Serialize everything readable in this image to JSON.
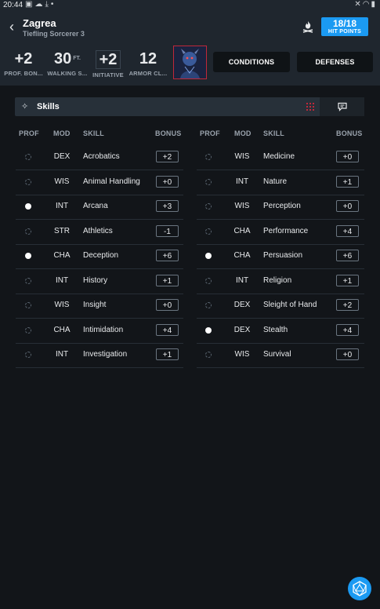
{
  "status_bar": {
    "time": "20:44",
    "left_icons": [
      "image-icon",
      "cloud-icon",
      "download-icon",
      "dot-icon"
    ],
    "right_icons": [
      "mute-icon",
      "wifi-icon",
      "battery-icon"
    ]
  },
  "header": {
    "name": "Zagrea",
    "subtitle": "Tiefling Sorcerer 3",
    "hit_points": {
      "value": "18/18",
      "label": "HIT POINTS"
    },
    "stats": {
      "proficiency": {
        "value": "+2",
        "label": "PROF. BON..."
      },
      "walking": {
        "value": "30",
        "unit": "FT.",
        "label": "WALKING S..."
      },
      "initiative": {
        "value": "+2",
        "label": "INITIATIVE"
      },
      "armor": {
        "value": "12",
        "label": "ARMOR CL..."
      }
    },
    "buttons": {
      "conditions": "CONDITIONS",
      "defenses": "DEFENSES"
    }
  },
  "skills_panel": {
    "title": "Skills",
    "columns": {
      "prof": "PROF",
      "mod": "MOD",
      "skill": "SKILL",
      "bonus": "BONUS"
    }
  },
  "skills_left": [
    {
      "prof": false,
      "mod": "DEX",
      "skill": "Acrobatics",
      "bonus": "+2"
    },
    {
      "prof": false,
      "mod": "WIS",
      "skill": "Animal Handling",
      "bonus": "+0"
    },
    {
      "prof": true,
      "mod": "INT",
      "skill": "Arcana",
      "bonus": "+3"
    },
    {
      "prof": false,
      "mod": "STR",
      "skill": "Athletics",
      "bonus": "-1"
    },
    {
      "prof": true,
      "mod": "CHA",
      "skill": "Deception",
      "bonus": "+6"
    },
    {
      "prof": false,
      "mod": "INT",
      "skill": "History",
      "bonus": "+1"
    },
    {
      "prof": false,
      "mod": "WIS",
      "skill": "Insight",
      "bonus": "+0"
    },
    {
      "prof": false,
      "mod": "CHA",
      "skill": "Intimidation",
      "bonus": "+4"
    },
    {
      "prof": false,
      "mod": "INT",
      "skill": "Investigation",
      "bonus": "+1"
    }
  ],
  "skills_right": [
    {
      "prof": false,
      "mod": "WIS",
      "skill": "Medicine",
      "bonus": "+0"
    },
    {
      "prof": false,
      "mod": "INT",
      "skill": "Nature",
      "bonus": "+1"
    },
    {
      "prof": false,
      "mod": "WIS",
      "skill": "Perception",
      "bonus": "+0"
    },
    {
      "prof": false,
      "mod": "CHA",
      "skill": "Performance",
      "bonus": "+4"
    },
    {
      "prof": true,
      "mod": "CHA",
      "skill": "Persuasion",
      "bonus": "+6"
    },
    {
      "prof": false,
      "mod": "INT",
      "skill": "Religion",
      "bonus": "+1"
    },
    {
      "prof": false,
      "mod": "DEX",
      "skill": "Sleight of Hand",
      "bonus": "+2"
    },
    {
      "prof": true,
      "mod": "DEX",
      "skill": "Stealth",
      "bonus": "+4"
    },
    {
      "prof": false,
      "mod": "WIS",
      "skill": "Survival",
      "bonus": "+0"
    }
  ],
  "colors": {
    "accent": "#1b9af2",
    "background": "#121519",
    "header": "#1f262e",
    "portrait_border": "#c0283a"
  }
}
